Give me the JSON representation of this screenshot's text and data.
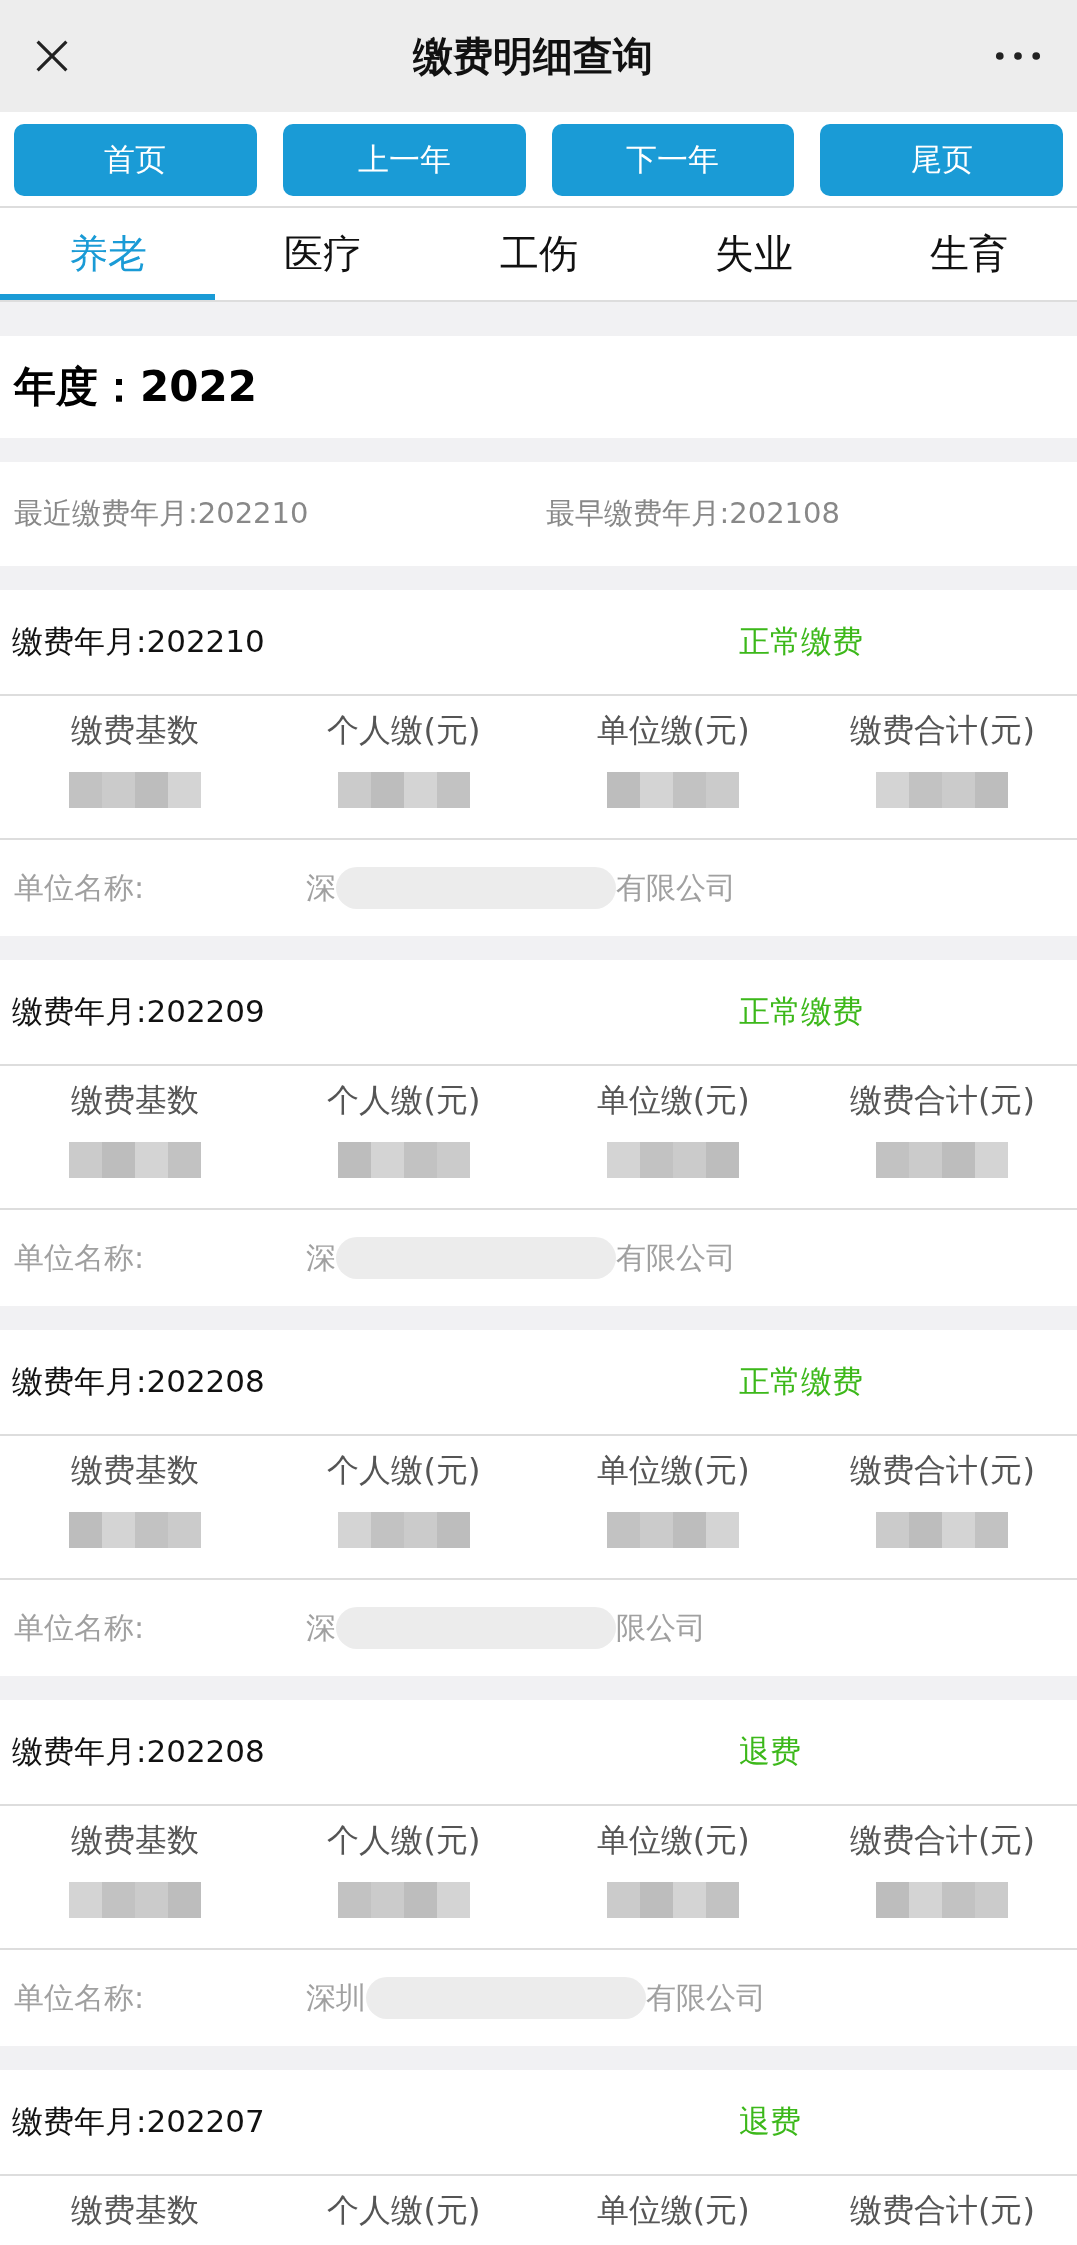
{
  "top_bar": {
    "title": "缴费明细查询"
  },
  "nav_buttons": [
    "首页",
    "上一年",
    "下一年",
    "尾页"
  ],
  "tabs": [
    {
      "label": "养老",
      "selected": true
    },
    {
      "label": "医疗",
      "selected": false
    },
    {
      "label": "工伤",
      "selected": false
    },
    {
      "label": "失业",
      "selected": false
    },
    {
      "label": "生育",
      "selected": false
    }
  ],
  "year": "年度：2022",
  "summary": {
    "latest": "最近缴费年月:202210",
    "earliest": "最早缴费年月:202108"
  },
  "records": [
    {
      "month": "缴费年月:202210",
      "status": "正常缴费",
      "columns": [
        "缴费基数",
        "个人缴(元)",
        "单位缴(元)",
        "缴费合计(元)"
      ],
      "company_label": "单位名称:",
      "company_start": "深",
      "company_end": "有限公司"
    },
    {
      "month": "缴费年月:202209",
      "status": "正常缴费",
      "columns": [
        "缴费基数",
        "个人缴(元)",
        "单位缴(元)",
        "缴费合计(元)"
      ],
      "company_label": "单位名称:",
      "company_start": "深",
      "company_end": "有限公司"
    },
    {
      "month": "缴费年月:202208",
      "status": "正常缴费",
      "columns": [
        "缴费基数",
        "个人缴(元)",
        "单位缴(元)",
        "缴费合计(元)"
      ],
      "company_label": "单位名称:",
      "company_start": "深",
      "company_end": "限公司"
    },
    {
      "month": "缴费年月:202208",
      "status": "退费",
      "columns": [
        "缴费基数",
        "个人缴(元)",
        "单位缴(元)",
        "缴费合计(元)"
      ],
      "company_label": "单位名称:",
      "company_start": "深圳",
      "company_end": "有限公司"
    },
    {
      "month": "缴费年月:202207",
      "status": "退费",
      "columns": [
        "缴费基数",
        "个人缴(元)",
        "单位缴(元)",
        "缴费合计(元)"
      ]
    }
  ]
}
